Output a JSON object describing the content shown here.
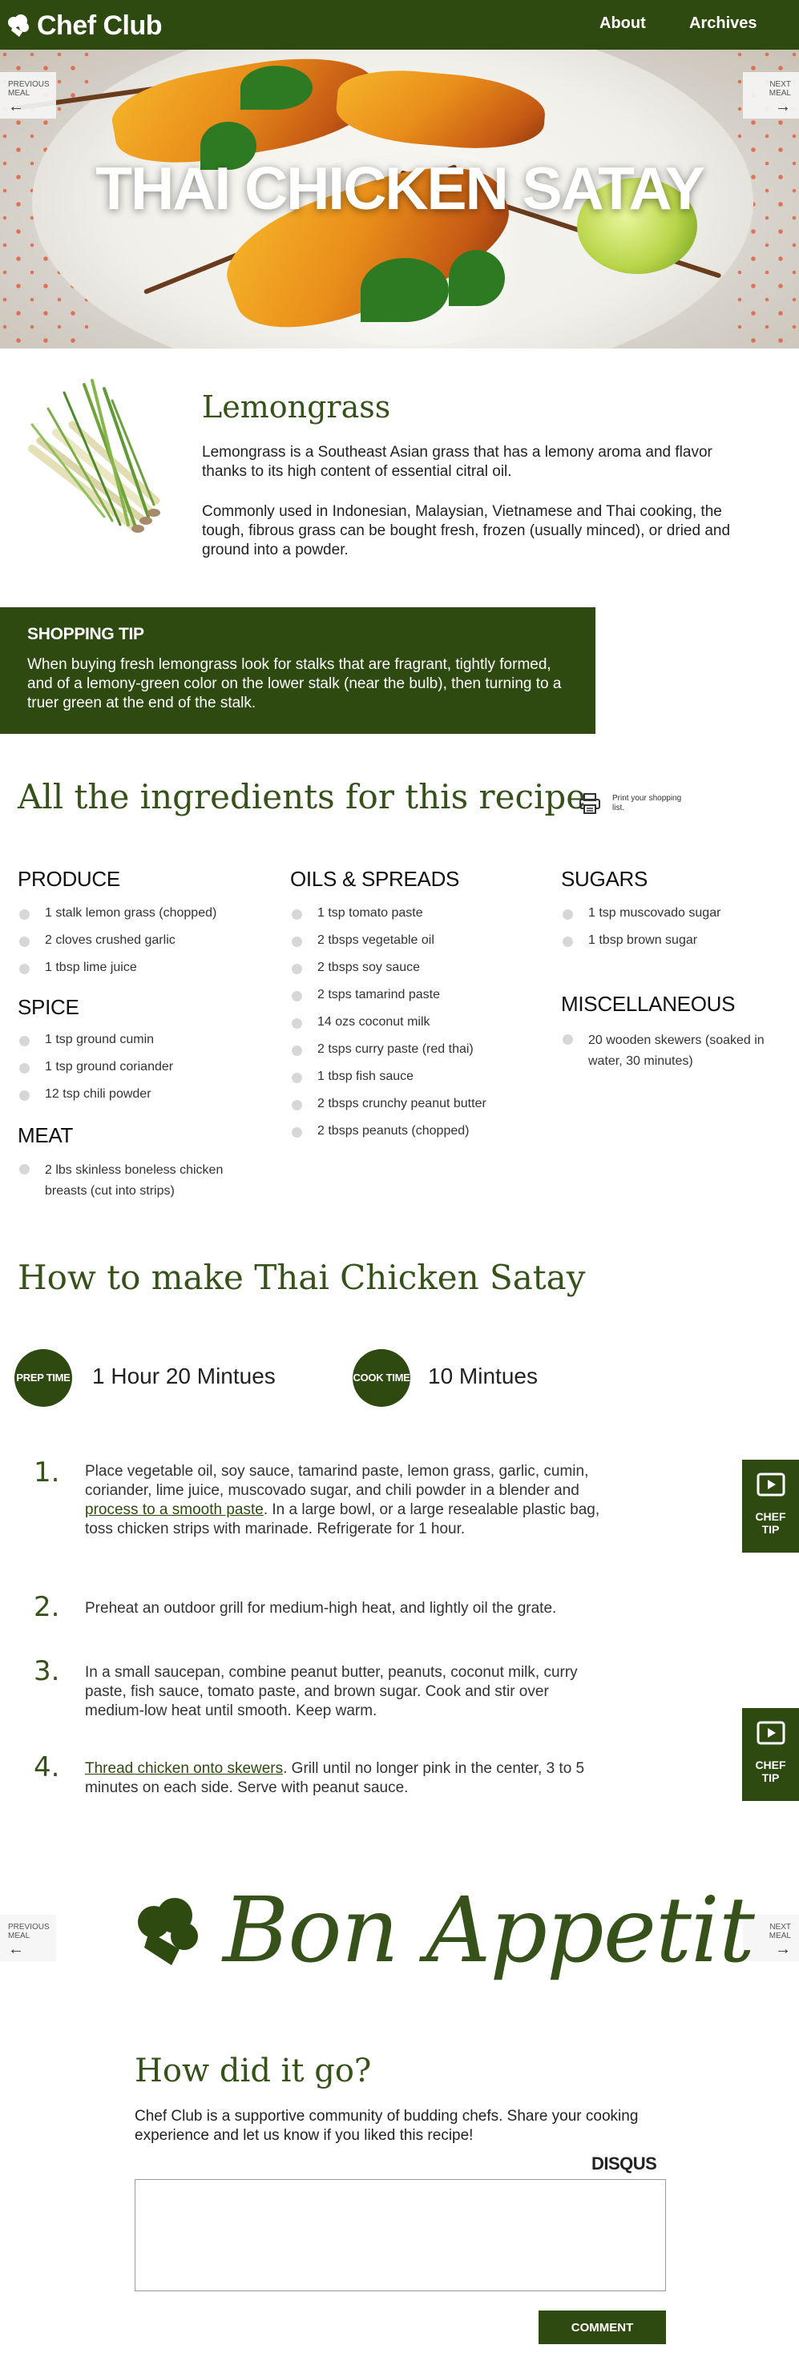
{
  "header": {
    "logo_text": "Chef Club",
    "nav": [
      {
        "label": "About"
      },
      {
        "label": "Archives"
      }
    ]
  },
  "hero": {
    "title": "THAI CHICKEN SATAY",
    "prev_label": "PREVIOUS MEAL",
    "next_label": "NEXT MEAL"
  },
  "lemongrass": {
    "title": "Lemongrass",
    "p1": "Lemongrass is a Southeast Asian grass that has a lemony aroma and flavor thanks to its high content of essential citral oil.",
    "p2": "Commonly used in Indonesian, Malaysian, Vietnamese and Thai cooking, the tough, fibrous grass can be bought fresh, frozen (usually minced), or dried and ground into a powder."
  },
  "shopping_tip": {
    "heading": "SHOPPING TIP",
    "body": "When buying fresh lemongrass look for stalks that are fragrant, tightly formed, and of a lemony-green color on the lower stalk (near the bulb), then turning to a truer green at the end of the stalk."
  },
  "ingredients": {
    "title": "All the ingredients for this recipe",
    "print_label": "Print your shopping list.",
    "categories": [
      {
        "name": "PRODUCE",
        "items": [
          "1 stalk lemon grass (chopped)",
          "2 cloves crushed garlic",
          "1 tbsp lime juice"
        ]
      },
      {
        "name": "SPICE",
        "items": [
          "1 tsp ground cumin",
          "1 tsp ground coriander",
          "12 tsp chili powder"
        ]
      },
      {
        "name": "MEAT",
        "items": [
          "2 lbs skinless boneless chicken breasts (cut into strips)"
        ]
      },
      {
        "name": "OILS & SPREADS",
        "items": [
          "1 tsp tomato paste",
          "2 tbsps vegetable oil",
          "2 tbsps soy sauce",
          "2 tsps tamarind paste",
          "14 ozs coconut milk",
          "2 tsps curry paste (red thai)",
          "1 tbsp fish sauce",
          "2 tbsps crunchy peanut butter",
          "2 tbsps peanuts (chopped)"
        ]
      },
      {
        "name": "SUGARS",
        "items": [
          "1 tsp muscovado sugar",
          "1 tbsp brown sugar"
        ]
      },
      {
        "name": "MISCELLANEOUS",
        "items": [
          "20 wooden skewers (soaked in water, 30 minutes)"
        ]
      }
    ]
  },
  "howto": {
    "title": "How to make Thai Chicken Satay",
    "prep_label": "PREP TIME",
    "prep_time": "1 Hour 20 Mintues",
    "cook_label": "COOK TIME",
    "cook_time": "10 Mintues",
    "chef_tip_label": "CHEF TIP",
    "steps": [
      {
        "num": "1.",
        "before": "Place vegetable oil, soy sauce, tamarind paste, lemon grass, garlic, cumin, coriander, lime juice, muscovado sugar, and chili powder in a blender and ",
        "link": "process to a smooth paste",
        "after": ". In a large bowl, or a large resealable plastic bag, toss chicken strips with marinade. Refrigerate for 1 hour."
      },
      {
        "num": "2.",
        "before": "Preheat an outdoor grill for medium-high heat, and lightly oil the grate.",
        "link": "",
        "after": ""
      },
      {
        "num": "3.",
        "before": "In a small saucepan, combine peanut butter, peanuts, coconut milk, curry paste, fish sauce, tomato paste, and brown sugar. Cook and stir over medium-low heat until smooth. Keep warm.",
        "link": "",
        "after": ""
      },
      {
        "num": "4.",
        "before": "",
        "link": "Thread chicken onto skewers",
        "after": ". Grill until no longer pink in the center, 3 to 5 minutes on each side. Serve with peanut sauce."
      }
    ]
  },
  "bon_appetit": {
    "text": "Bon Appetit",
    "prev_label": "PREVIOUS MEAL",
    "next_label": "NEXT MEAL"
  },
  "comments": {
    "title": "How did it go?",
    "body": "Chef Club is a supportive community of budding chefs. Share your cooking experience and let us know if you liked this recipe!",
    "brand": "DISQUS",
    "textarea_value": "",
    "button_label": "COMMENT"
  }
}
